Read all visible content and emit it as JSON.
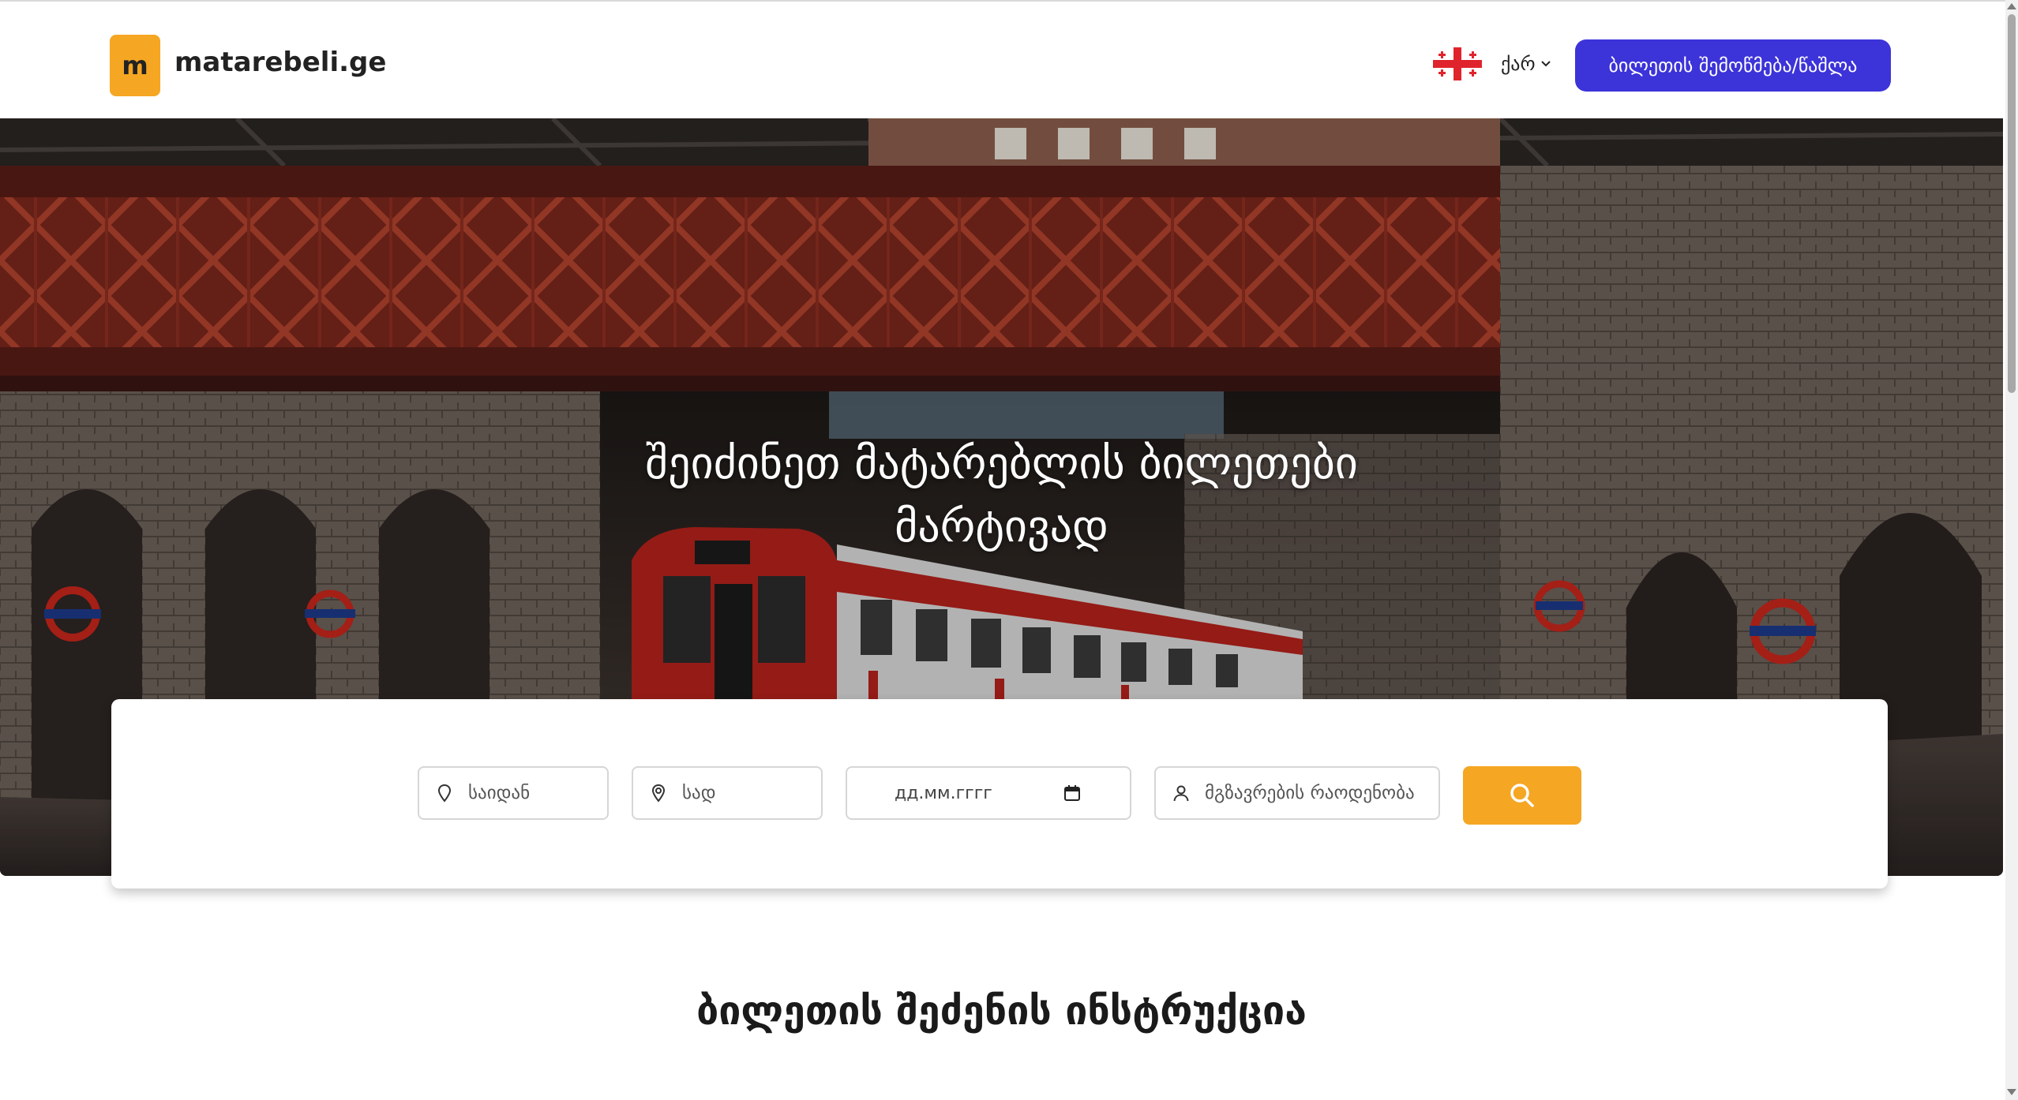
{
  "header": {
    "logo_letter": "m",
    "brand": "matarebeli.ge",
    "language": {
      "label": "ქარ",
      "flag_icon": "georgia-flag-icon"
    },
    "check_ticket_button": "ბილეთის შემოწმება/წაშლა"
  },
  "hero": {
    "title_line1": "შეიძინეთ მატარებლის ბილეთები",
    "title_line2": "მარტივად"
  },
  "search": {
    "from_placeholder": "საიდან",
    "to_placeholder": "სად",
    "date_placeholder": "дд.мм.гггг",
    "passengers_placeholder": "მგზავრების რაოდენობა"
  },
  "section": {
    "title": "ბილეთის შეძენის ინსტრუქცია"
  },
  "colors": {
    "accent_orange": "#f5a623",
    "primary_blue": "#3c33d9"
  }
}
